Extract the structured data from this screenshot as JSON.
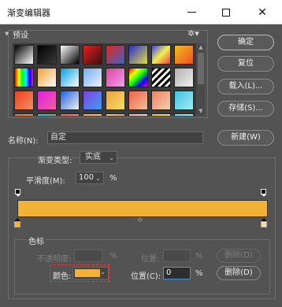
{
  "window": {
    "title": "渐变编辑器",
    "minimize": "—",
    "maximize": "☐",
    "close": "✕"
  },
  "presets": {
    "label": "预设",
    "gear_icon": "gear-icon",
    "swatches": [
      "linear-gradient(135deg,#000,#fff)",
      "linear-gradient(135deg,#000,rgba(0,0,0,0))",
      "linear-gradient(135deg,#ffffff,#000000)",
      "linear-gradient(135deg,#e02020,#401010)",
      "linear-gradient(135deg,#e8231e,#3a62c8)",
      "linear-gradient(135deg,#2a2ad0,#e0e040)",
      "linear-gradient(135deg,#3a3af0,#f0f050,#f04040)",
      "linear-gradient(135deg,#f0c020,#f05020)",
      "linear-gradient(90deg,#f00,#ff0,#0f0,#0ff,#00f,#f0f)",
      "linear-gradient(135deg,#f0a030,#ffffff)",
      "linear-gradient(135deg,#00a0e0,#ffffff)",
      "linear-gradient(135deg,#70b0f0,#f0f0ff)",
      "linear-gradient(135deg,#e040a0,#f0a0f0)",
      "linear-gradient(135deg,#f00,#ff0,#0f0,#00f,#f0f)",
      "repeating-linear-gradient(135deg,#000 0 3px,#fff 3px 6px)",
      "linear-gradient(135deg,#b0b0b0,#f0f0f0)",
      "linear-gradient(135deg,#f04020,#f09060)",
      "linear-gradient(135deg,#e020e0,#f060a0)",
      "linear-gradient(135deg,#2060e0,#f0f0f0)",
      "linear-gradient(135deg,#8040e0,#40a0f0)",
      "linear-gradient(135deg,#f0a040,#f0e060)",
      "linear-gradient(135deg,#f06040,#f0c0a0)",
      "linear-gradient(135deg,#f08060,#f0d0b0)",
      "linear-gradient(135deg,#40c0e0,#a0f0f0)",
      "linear-gradient(135deg,#f07030,#f0a050)",
      "linear-gradient(135deg,#20c0e0,#f08040)",
      "linear-gradient(135deg,#f06060,#f0a0a0)",
      "linear-gradient(135deg,#f0a060,#f0e0a0)",
      "linear-gradient(135deg,#f0c080,#f08060)",
      "linear-gradient(135deg,#f0b0b0,#f0f0f0)",
      "linear-gradient(135deg,#f0c040,#f0f0a0)",
      "linear-gradient(135deg,#60e0f0,#c0f0f0)"
    ]
  },
  "buttons": {
    "ok": "确定",
    "reset": "复位",
    "load": "载入(L)...",
    "save": "存储(S)...",
    "new": "新建(W)"
  },
  "name": {
    "label": "名称(N):",
    "value": "自定"
  },
  "gradient_type": {
    "label": "渐变类型:",
    "value": "实底"
  },
  "smoothness": {
    "label": "平滑度(M):",
    "value": "100",
    "unit": "%"
  },
  "gradient": {
    "color": "#f1b236",
    "midpoint": "◇",
    "left_stop_color": "#f1b236",
    "right_stop_color": "#f8dca8"
  },
  "stops": {
    "label": "色标",
    "opacity_label": "不透明度:",
    "opacity_unit": "%",
    "location_label": "位置:",
    "location_unit": "%",
    "delete_label_disabled": "删除(D)",
    "color_label": "颜色:",
    "color_location_label": "位置(C):",
    "color_location_value": "0",
    "color_location_unit": "%",
    "delete_label": "删除(D)"
  }
}
